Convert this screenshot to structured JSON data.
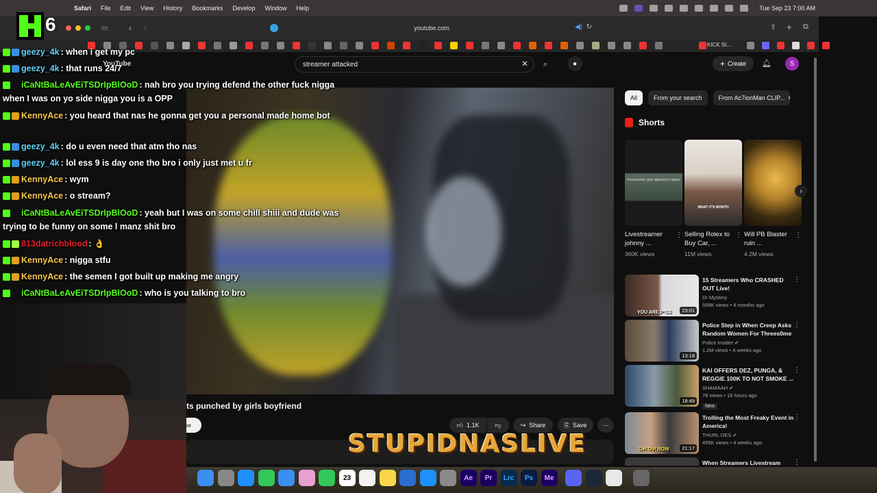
{
  "menubar": {
    "app": "Safari",
    "items": [
      "File",
      "Edit",
      "View",
      "History",
      "Bookmarks",
      "Develop",
      "Window",
      "Help"
    ],
    "datetime": "Tue Sep 23  7:00 AM"
  },
  "safari": {
    "url": "youtube.com",
    "favorite_label": "KICK St..."
  },
  "youtube": {
    "logo": "YouTube",
    "search_query": "streamer attacked",
    "create_label": "Create",
    "avatar_letter": "S",
    "video_title": "ts punched by girls boyfriend",
    "subscribe_fragment": "be",
    "like_count": "1.1K",
    "share_label": "Share",
    "save_label": "Save",
    "chips": [
      "All",
      "From your search",
      "From Ac7ionMan CLIP..."
    ],
    "shorts_header": "Shorts",
    "shorts": [
      {
        "title": "Livestreamer johnny ...",
        "views": "360K views",
        "caption": "livestreamer gets attacked in japan"
      },
      {
        "title": "Selling Rolex to Buy Car, ...",
        "views": "11M views",
        "caption": "WHAT IT'S WORTH"
      },
      {
        "title": "Will PB Blaster ruin ...",
        "views": "4.2M views",
        "caption": ""
      }
    ],
    "related": [
      {
        "title": "15 Streamers Who CRASHED OUT Live!",
        "channel": "Dr Mystery",
        "meta": "599K views • 4 months ago",
        "duration": "23:01",
        "verified": false,
        "badge": "",
        "overlay": "YOU ARE P*SS"
      },
      {
        "title": "Police Step in When Creep Asks Random Women For Threes0me",
        "channel": "Police Insider",
        "meta": "1.2M views • 4 weeks ago",
        "duration": "13:18",
        "verified": true,
        "badge": "",
        "overlay": ""
      },
      {
        "title": "KAI OFFERS DEZ, PUNGA, & REGGIE 100K TO NOT SMOKE ...",
        "channel": "SHAMAAH",
        "meta": "78 views • 18 hours ago",
        "duration": "18:49",
        "verified": true,
        "badge": "New",
        "overlay": ""
      },
      {
        "title": "Trolling the Most Freaky Event in America!",
        "channel": "THURL DES",
        "meta": "495K views • 4 weeks ago",
        "duration": "21:17",
        "verified": true,
        "badge": "",
        "overlay": "Get Out NOW"
      },
      {
        "title": "When Streamers Livestream",
        "channel": "",
        "meta": "",
        "duration": "",
        "verified": false,
        "badge": "",
        "overlay": ""
      }
    ]
  },
  "stream": {
    "viewer_count": "6",
    "branding": "STUPIDNASLIVE",
    "chat": [
      {
        "user": "geezy_4k",
        "color": "#5fd0f0",
        "text": ": when i get my pc"
      },
      {
        "user": "geezy_4k",
        "color": "#5fd0f0",
        "text": ": that runs 24/7"
      },
      {
        "user": "iCaNtBaLeAvEiTSDrIpBlOoD",
        "color": "#53fc18",
        "text": ": nah bro you trying defend the other fuck nigga when I was on yo side nigga you is a OPP"
      },
      {
        "user": "KennyAce",
        "color": "#f7c948",
        "text": ": you heard that nas he gonna get you a personal made home bot"
      },
      {
        "user": "geezy_4k",
        "color": "#5fd0f0",
        "text": ": do u even need that atm tho nas"
      },
      {
        "user": "geezy_4k",
        "color": "#5fd0f0",
        "text": ": lol ess 9 is day one tho bro i only just met u fr"
      },
      {
        "user": "KennyAce",
        "color": "#f7c948",
        "text": ": wym"
      },
      {
        "user": "KennyAce",
        "color": "#f7c948",
        "text": ": o stream?"
      },
      {
        "user": "iCaNtBaLeAvEiTSDrIpBlOoD",
        "color": "#53fc18",
        "text": ": yeah but I was on some chill shiii and dude was trying to be funny on some l manz shit bro"
      },
      {
        "user": "813datrichblood",
        "color": "#e0202a",
        "text": ": 👌"
      },
      {
        "user": "KennyAce",
        "color": "#f7c948",
        "text": ": nigga stfu"
      },
      {
        "user": "KennyAce",
        "color": "#f7c948",
        "text": ": the semen I got built up making me angry"
      },
      {
        "user": "iCaNtBaLeAvEiTSDrIpBlOoD",
        "color": "#53fc18",
        "text": ": who is you talking to bro"
      }
    ]
  },
  "dock": {
    "apps": [
      "Finder",
      "Launchpad",
      "Safari",
      "Messages",
      "Mail",
      "Photos",
      "FaceTime",
      "Calendar",
      "Reminders",
      "Notes",
      "Freeform",
      "App Store",
      "Settings",
      "Ae",
      "Pr",
      "Lrc",
      "Ps",
      "Me",
      "Discord",
      "Steam",
      "Chrome",
      "Trash"
    ],
    "calendar_day": "23"
  },
  "colors": {
    "kick_green": "#53fc18",
    "youtube_red": "#e62117",
    "accent_purple": "#9c27b0"
  }
}
